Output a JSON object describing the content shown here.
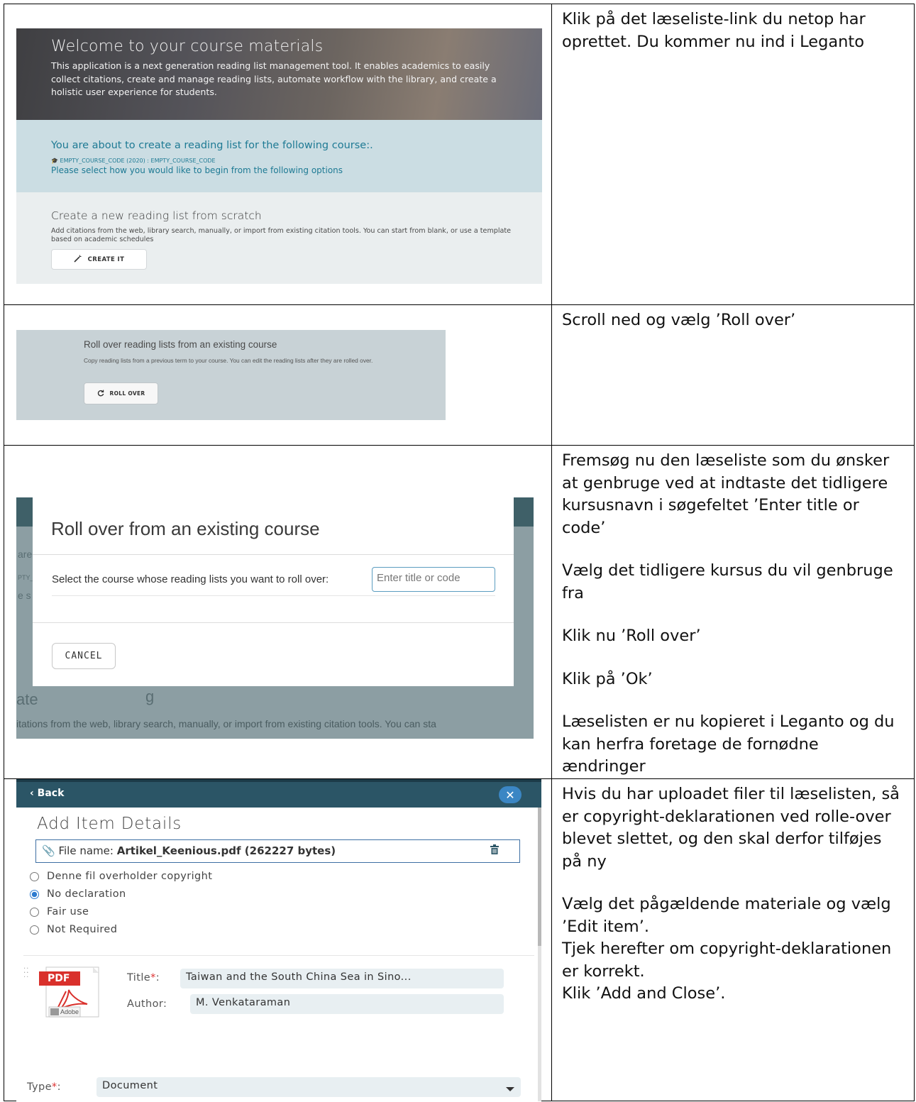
{
  "instructions": {
    "row1": [
      "Klik på det læseliste-link du netop har oprettet. Du kommer nu ind i Leganto"
    ],
    "row2": [
      "Scroll ned og vælg ’Roll over’"
    ],
    "row3": [
      "Fremsøg nu den læseliste som du ønsker at genbruge ved at indtaste det tidligere kursusnavn i søgefeltet ’Enter title or code’",
      "Vælg det tidligere kursus du vil genbruge fra",
      "Klik nu ’Roll over’",
      "Klik på ’Ok’",
      "Læselisten er nu kopieret i Leganto og du kan herfra foretage de fornødne ændringer"
    ],
    "row4": [
      "Hvis du har uploadet filer til læselisten, så er copyright-deklarationen ved rolle-over blevet slettet, og den skal derfor tilføjes på ny",
      "Vælg det pågældende materiale og vælg ’Edit item’.",
      "Tjek herefter om copyright-deklarationen er korrekt.",
      "Klik ’Add and Close’."
    ]
  },
  "shot1": {
    "hero_title": "Welcome to your course materials",
    "hero_text": "This application is a next generation reading list management tool. It enables academics to easily collect citations, create and manage reading lists, automate workflow with the library, and create a holistic user experience for students.",
    "about_title": "You are about to create a reading list for the following course:.",
    "course_code": "EMPTY_COURSE_CODE (2020) : EMPTY_COURSE_CODE",
    "select_text": "Please select how you would like to begin from the following options",
    "create_title": "Create a new reading list from scratch",
    "create_text": "Add citations from the web, library search, manually, or import from existing citation tools. You can start from blank, or use a template based on academic schedules",
    "create_button": "CREATE IT"
  },
  "shot2": {
    "title": "Roll over reading lists from an existing course",
    "text": "Copy reading lists from a previous term to your course. You can edit the reading lists after they are rolled over.",
    "button": "ROLL OVER"
  },
  "shot3": {
    "modal_title": "Roll over from an existing course",
    "select_label": "Select the course whose reading lists you want to roll over:",
    "input_placeholder": "Enter title or code",
    "cancel_button": "CANCEL",
    "peek_1": "are",
    "peek_2": "PTY_",
    "peek_3": "e s",
    "peek_4": "ate",
    "peek_5": "g",
    "bottom_text": "itations from the web, library search, manually, or import from existing citation tools. You can sta"
  },
  "shot4": {
    "back": "Back",
    "close": "✕",
    "title": "Add Item Details",
    "file_label": "File name:",
    "file_name": "Artikel_Keenious.pdf (262227 bytes)",
    "radios": [
      {
        "label": "Denne fil overholder copyright",
        "selected": false
      },
      {
        "label": "No declaration",
        "selected": true
      },
      {
        "label": "Fair use",
        "selected": false
      },
      {
        "label": "Not Required",
        "selected": false
      }
    ],
    "title_label": "Title",
    "title_value": "Taiwan and the South China Sea in Sino...",
    "author_label": "Author:",
    "author_value": "M. Venkataraman",
    "type_label": "Type",
    "type_value": "Document",
    "required_mark": "*",
    "colon": ":",
    "pdf_badge": "PDF",
    "adobe_label": "Adobe"
  }
}
